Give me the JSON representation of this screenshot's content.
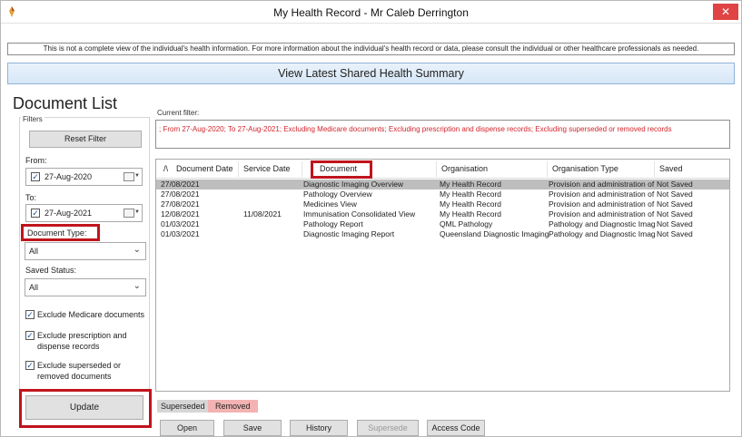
{
  "window": {
    "title": "My Health Record - Mr Caleb Derrington",
    "close_glyph": "✕"
  },
  "banner": {
    "text": "This is not a complete view of the individual's health information. For more information about the individual's health record or data, please consult the individual or other healthcare professionals as needed."
  },
  "summary": {
    "label": "View Latest Shared Health Summary"
  },
  "document_list": {
    "title": "Document List",
    "filters_label": "Filters",
    "reset_filter": "Reset Filter",
    "from_label": "From:",
    "from_value": "27-Aug-2020",
    "to_label": "To:",
    "to_value": "27-Aug-2021",
    "doc_type_label": "Document Type:",
    "doc_type_value": "All",
    "saved_status_label": "Saved Status:",
    "saved_status_value": "All",
    "checkboxes": [
      {
        "label": "Exclude Medicare documents",
        "checked": true
      },
      {
        "label": "Exclude prescription and dispense records",
        "line1": "Exclude prescription and",
        "line2": "dispense records",
        "checked": true
      },
      {
        "label": "Exclude superseded or removed documents",
        "line1": "Exclude superseded or",
        "line2": "removed documents",
        "checked": true
      }
    ],
    "check_glyph": "✓",
    "update_label": "Update"
  },
  "current_filter": {
    "label": "Current filter:",
    "text": "; From 27-Aug-2020; To 27-Aug-2021; Excluding Medicare documents; Excluding prescription and dispense records; Excluding superseded or removed records"
  },
  "table": {
    "sort_glyph": "/\\",
    "columns": [
      "Document Date",
      "Service Date",
      "Document",
      "Organisation",
      "Organisation Type",
      "Saved"
    ],
    "rows": [
      [
        "27/08/2021",
        "",
        "Diagnostic Imaging Overview",
        "My Health Record",
        "Provision and administration of",
        "Not Saved"
      ],
      [
        "27/08/2021",
        "",
        "Pathology Overview",
        "My Health Record",
        "Provision and administration of",
        "Not Saved"
      ],
      [
        "27/08/2021",
        "",
        "Medicines View",
        "My Health Record",
        "Provision and administration of",
        "Not Saved"
      ],
      [
        "12/08/2021",
        "11/08/2021",
        "Immunisation Consolidated View",
        "My Health Record",
        "Provision and administration of",
        "Not Saved"
      ],
      [
        "01/03/2021",
        "",
        "Pathology Report",
        "QML Pathology",
        "Pathology and Diagnostic Imag",
        "Not Saved"
      ],
      [
        "01/03/2021",
        "",
        "Diagnostic Imaging Report",
        "Queensland Diagnostic Imaging",
        "Pathology and Diagnostic Imag",
        "Not Saved"
      ]
    ],
    "selected_row": 0
  },
  "legend": {
    "superseded": "Superseded",
    "removed": "Removed"
  },
  "actions": {
    "open": "Open",
    "save": "Save",
    "history": "History",
    "supersede": "Supersede",
    "access_code": "Access Code"
  },
  "colors": {
    "highlight": "#c0141c",
    "filter_text": "#d2242b",
    "selected_row": "#bebebe",
    "removed_legend": "#f3b3b3",
    "superseded_legend": "#d6d6d6",
    "close_button": "#e04343"
  }
}
